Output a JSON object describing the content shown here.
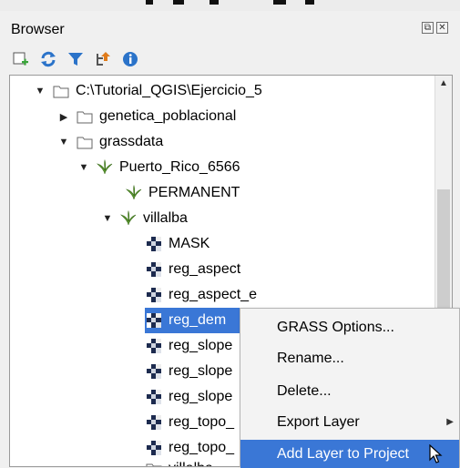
{
  "panel": {
    "title": "Browser",
    "float_glyph": "⧉",
    "close_glyph": "✕"
  },
  "toolbar": {
    "icons": [
      "add-selected-layers-icon",
      "refresh-icon",
      "filter-icon",
      "collapse-all-icon",
      "info-icon"
    ]
  },
  "tree": {
    "root": {
      "label": "C:\\Tutorial_QGIS\\Ejercicio_5",
      "expanded": true
    },
    "items": [
      {
        "label": "genetica_poblacional",
        "type": "folder",
        "expanded": false
      },
      {
        "label": "grassdata",
        "type": "folder",
        "expanded": true
      },
      {
        "label": "Puerto_Rico_6566",
        "type": "grass-location",
        "expanded": true
      },
      {
        "label": "PERMANENT",
        "type": "grass-mapset"
      },
      {
        "label": "villalba",
        "type": "grass-mapset",
        "expanded": true
      },
      {
        "label": "MASK",
        "type": "raster"
      },
      {
        "label": "reg_aspect",
        "type": "raster"
      },
      {
        "label": "reg_aspect_e",
        "type": "raster"
      },
      {
        "label": "reg_dem",
        "type": "raster",
        "selected": true
      },
      {
        "label": "reg_slope",
        "type": "raster"
      },
      {
        "label": "reg_slope",
        "type": "raster"
      },
      {
        "label": "reg_slope",
        "type": "raster"
      },
      {
        "label": "reg_topo_",
        "type": "raster"
      },
      {
        "label": "reg_topo_",
        "type": "raster"
      },
      {
        "label": "villalba",
        "type": "folder"
      }
    ]
  },
  "context_menu": {
    "items": [
      {
        "label": "GRASS Options..."
      },
      {
        "label": "Rename..."
      },
      {
        "label": "Delete..."
      },
      {
        "label": "Export Layer",
        "has_submenu": true
      },
      {
        "label": "Add Layer to Project",
        "highlighted": true
      }
    ]
  },
  "colors": {
    "selection": "#3a77d6",
    "grass_green": "#5b9b2f"
  }
}
